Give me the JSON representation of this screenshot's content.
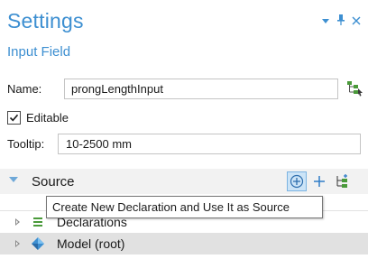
{
  "header": {
    "title": "Settings",
    "subtitle": "Input Field",
    "controls": {
      "dropdown_icon": "chevron-down-icon",
      "pin_icon": "pin-icon",
      "close_icon": "close-icon"
    }
  },
  "form": {
    "name": {
      "label": "Name:",
      "value": "prongLengthInput",
      "button_icon": "select-node-icon"
    },
    "editable": {
      "label": "Editable",
      "checked": true
    },
    "tooltip": {
      "label": "Tooltip:",
      "value": "10-2500 mm"
    }
  },
  "source": {
    "label": "Source",
    "tools": [
      "create-declaration-icon",
      "add-icon",
      "tree-add-icon"
    ],
    "hover_tooltip": "Create New Declaration and Use It as Source"
  },
  "tree": {
    "items": [
      {
        "label": "Declarations",
        "icon": "declarations-icon"
      },
      {
        "label": "Model (root)",
        "icon": "model-icon",
        "selected": true
      }
    ]
  },
  "colors": {
    "accent": "#3d8fd1",
    "section_bg": "#f2f2f2",
    "selected_row": "#e1e1e1",
    "active_tool_bg": "#cce4f7"
  }
}
